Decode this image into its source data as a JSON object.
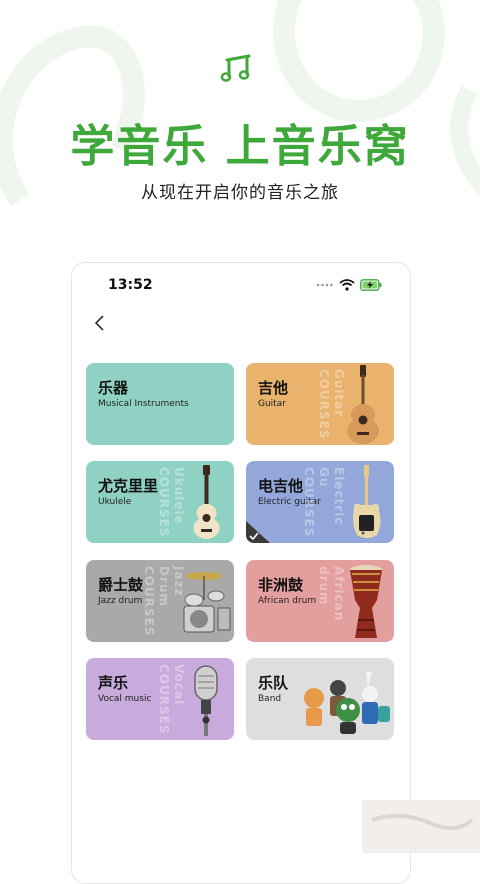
{
  "hero": {
    "title": "学音乐 上音乐窝",
    "subtitle": "从现在开启你的音乐之旅",
    "accent_color": "#3ea83a",
    "icon": "music-note-icon"
  },
  "phone": {
    "status_time": "13:52",
    "status_icons": [
      "dots-icon",
      "wifi-icon",
      "battery-charging-icon"
    ],
    "back_icon": "chevron-left-icon"
  },
  "cards": [
    {
      "title": "乐器",
      "subtitle": "Musical Instruments",
      "watermark": "",
      "color": "#8fd2c3",
      "art": "none"
    },
    {
      "title": "吉他",
      "subtitle": "Guitar",
      "watermark": "Guitar COURSES",
      "color": "#e9b36e",
      "art": "acoustic-guitar"
    },
    {
      "title": "尤克里里",
      "subtitle": "Ukulele",
      "watermark": "Ukulele COURSES",
      "color": "#8fd2c3",
      "art": "ukulele"
    },
    {
      "title": "电吉他",
      "subtitle": "Electric guitar",
      "watermark": "Electric Gu COURSES",
      "color": "#93a7da",
      "art": "electric-guitar",
      "selected": true
    },
    {
      "title": "爵士鼓",
      "subtitle": "Jazz drum",
      "watermark": "Jazz Drum COURSES",
      "color": "#a9a9a9",
      "art": "drum-kit"
    },
    {
      "title": "非洲鼓",
      "subtitle": "African drum",
      "watermark": "African drum",
      "color": "#e39e9e",
      "art": "djembe"
    },
    {
      "title": "声乐",
      "subtitle": "Vocal music",
      "watermark": "Vocal COURSES",
      "color": "#c8abdc",
      "art": "microphone"
    },
    {
      "title": "乐队",
      "subtitle": "Band",
      "watermark": "",
      "color": "#dedede",
      "art": "band-characters"
    }
  ]
}
